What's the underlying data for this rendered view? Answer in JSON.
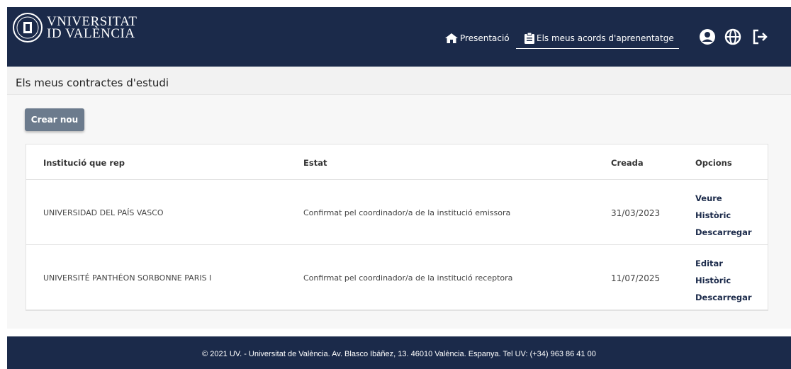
{
  "brand": {
    "line1": "VNIVERSITAT",
    "line2": "ID VALÈNCIA"
  },
  "nav": {
    "home_label": "Presentació",
    "acords_label": "Els meus acords d'aprenentatge"
  },
  "header_icons": [
    "user-icon",
    "globe-icon",
    "logout-icon"
  ],
  "page": {
    "title": "Els meus contractes d'estudi"
  },
  "actions": {
    "create_label": "Crear nou"
  },
  "table": {
    "columns": [
      "Institució que rep",
      "Estat",
      "Creada",
      "Opcions"
    ],
    "rows": [
      {
        "institution": "UNIVERSIDAD DEL PAÍS VASCO",
        "status": "Confirmat pel coordinador/a de la institució emissora",
        "created": "31/03/2023",
        "options": [
          "Veure",
          "Històric",
          "Descarregar"
        ]
      },
      {
        "institution": "UNIVERSITÉ PANTHÉON SORBONNE PARIS I",
        "status": "Confirmat pel coordinador/a de la institució receptora",
        "created": "11/07/2025",
        "options": [
          "Editar",
          "Històric",
          "Descarregar"
        ]
      }
    ]
  },
  "footer": {
    "text": "© 2021 UV. - Universitat de València. Av. Blasco Ibáñez, 13. 46010 València. Espanya. Tel UV: (+34) 963 86 41 00"
  },
  "colors": {
    "navy": "#1b2a4a",
    "button": "#6c7b8d",
    "link": "#1b2a4a"
  }
}
